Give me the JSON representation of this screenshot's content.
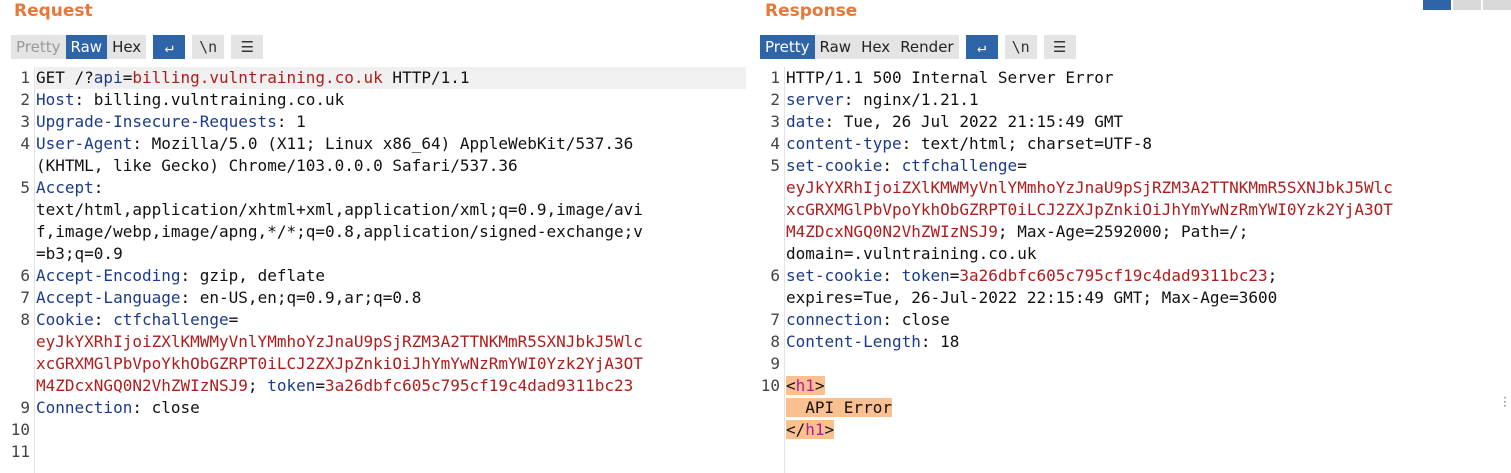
{
  "request": {
    "title": "Request",
    "tabs": [
      {
        "label": "Pretty",
        "state": "disabled"
      },
      {
        "label": "Raw",
        "state": "active"
      },
      {
        "label": "Hex",
        "state": "normal"
      }
    ],
    "tools": [
      {
        "name": "wrap-lines-icon",
        "glyph": "↵",
        "active": true
      },
      {
        "name": "newline-toggle-icon",
        "glyph": "\\n",
        "active": false
      },
      {
        "name": "menu-icon",
        "glyph": "☰",
        "active": false
      }
    ],
    "line_numbers": [
      "1",
      "2",
      "3",
      "4",
      "",
      "5",
      "",
      "",
      "",
      "6",
      "7",
      "8",
      "",
      "",
      "",
      "9",
      "10",
      "11"
    ]
  },
  "response": {
    "title": "Response",
    "tabs": [
      {
        "label": "Pretty",
        "state": "active"
      },
      {
        "label": "Raw",
        "state": "normal"
      },
      {
        "label": "Hex",
        "state": "normal"
      },
      {
        "label": "Render",
        "state": "normal"
      }
    ],
    "tools": [
      {
        "name": "wrap-lines-icon",
        "glyph": "↵",
        "active": true
      },
      {
        "name": "newline-toggle-icon",
        "glyph": "\\n",
        "active": false
      },
      {
        "name": "menu-icon",
        "glyph": "☰",
        "active": false
      }
    ]
  },
  "req_lines": {
    "l1": {
      "method": "GET /?",
      "param": "api",
      "eq": "=",
      "pval": "billing.vulntraining.co.uk",
      "proto": " HTTP/1.1"
    },
    "l2": {
      "k": "Host",
      "v": ": billing.vulntraining.co.uk"
    },
    "l3": {
      "k": "Upgrade-Insecure-Requests",
      "v": ": 1"
    },
    "l4": {
      "k": "User-Agent",
      "v": ": Mozilla/5.0 (X11; Linux x86_64) AppleWebKit/537.36",
      "v2": "(KHTML, like Gecko) Chrome/103.0.0.0 Safari/537.36"
    },
    "l5": {
      "k": "Accept",
      "v": ":",
      "w1": "text/html,application/xhtml+xml,application/xml;q=0.9,image/avi",
      "w2": "f,image/webp,image/apng,*/*;q=0.8,application/signed-exchange;v",
      "w3": "=b3;q=0.9"
    },
    "l6": {
      "k": "Accept-Encoding",
      "v": ": gzip, deflate"
    },
    "l7": {
      "k": "Accept-Language",
      "v": ": en-US,en;q=0.9,ar;q=0.8"
    },
    "l8": {
      "k": "Cookie",
      "v": ": ",
      "c1": "ctfchallenge",
      "c1eq": "=",
      "w1": "eyJkYXRhIjoiZXlKMWMyVnlYMmhoYzJnaU9pSjRZM3A2TTNKMmR5SXNJbkJ5Wlc",
      "w2": "xcGRXMGlPbVpoYkhObGZRPT0iLCJ2ZXJpZnkiOiJhYmYwNzRmYWI0Yzk2YjA3OT",
      "w3": "M4ZDcxNGQ0N2VhZWIzNSJ9",
      "sep": "; ",
      "c2": "token",
      "c2eq": "=",
      "c2v": "3a26dbfc605c795cf19c4dad9311bc23"
    },
    "l9": {
      "k": "Connection",
      "v": ": close"
    }
  },
  "res_lines": {
    "line_numbers": [
      "1",
      "2",
      "3",
      "4",
      "5",
      "",
      "",
      "",
      "",
      "6",
      "",
      "7",
      "8",
      "9",
      "10",
      "",
      ""
    ],
    "l1": "HTTP/1.1 500 Internal Server Error",
    "l2": {
      "k": "server",
      "v": ": nginx/1.21.1"
    },
    "l3": {
      "k": "date",
      "v": ": Tue, 26 Jul 2022 21:15:49 GMT"
    },
    "l4": {
      "k": "content-type",
      "v": ": text/html; charset=UTF-8"
    },
    "l5": {
      "k": "set-cookie",
      "v": ": ",
      "c": "ctfchallenge",
      "ceq": "=",
      "w1": "eyJkYXRhIjoiZXlKMWMyVnlYMmhoYzJnaU9pSjRZM3A2TTNKMmR5SXNJbkJ5Wlc",
      "w2": "xcGRXMGlPbVpoYkhObGZRPT0iLCJ2ZXJpZnkiOiJhYmYwNzRmYWI0Yzk2YjA3OT",
      "w3": "M4ZDcxNGQ0N2VhZWIzNSJ9",
      "w3b": "; Max-Age=2592000; Path=/;",
      "w4": "domain=.vulntraining.co.uk"
    },
    "l6": {
      "k": "set-cookie",
      "v": ": ",
      "c": "token",
      "ceq": "=",
      "cv": "3a26dbfc605c795cf19c4dad9311bc23",
      "semi": ";",
      "w2": "expires=Tue, 26-Jul-2022 22:15:49 GMT; Max-Age=3600"
    },
    "l7": {
      "k": "connection",
      "v": ": close"
    },
    "l8": {
      "k": "Content-Length",
      "v": ": 18"
    },
    "l10": {
      "open_lt": "<",
      "open_name": "h1",
      "open_gt": ">",
      "text": "  API Error",
      "close_lt": "</",
      "close_name": "h1",
      "close_gt": ">"
    }
  },
  "colors": {
    "accent": "#e8773a",
    "active_tab": "#2e65a8",
    "header_key": "#1a3a8c",
    "cookie": "#b01c1c",
    "tag_bg": "#fbc08f"
  }
}
